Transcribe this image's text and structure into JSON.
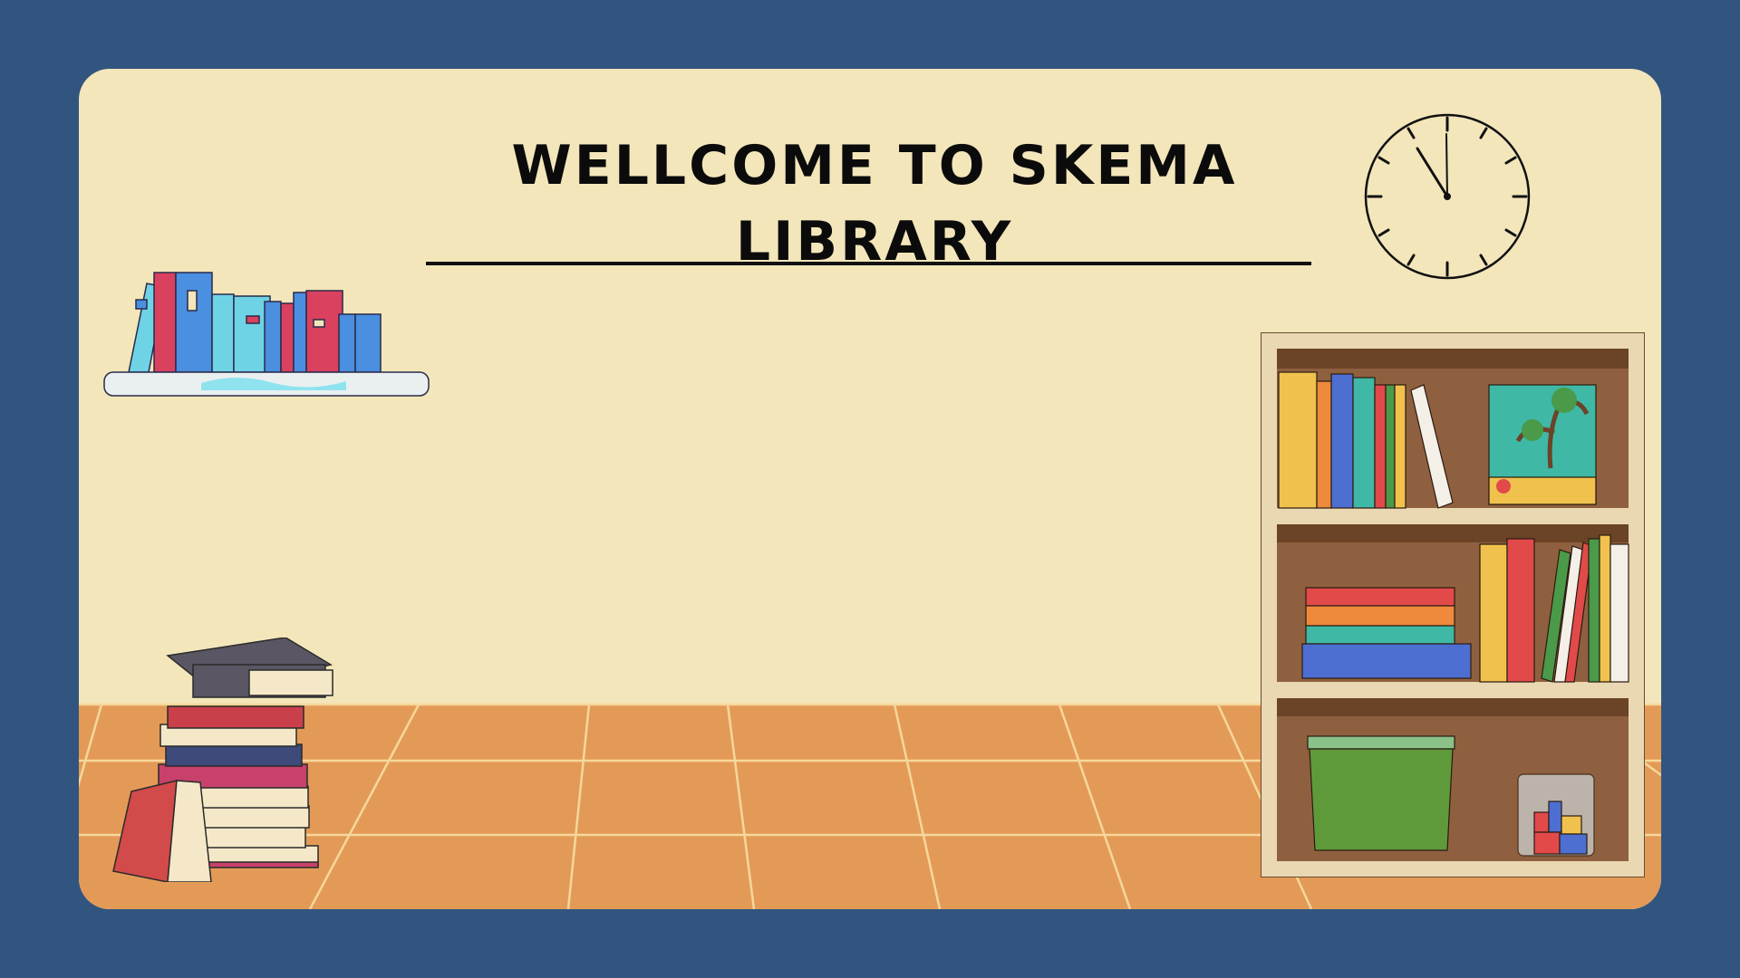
{
  "page": {
    "title": "WELLCOME TO SKEMA LIBRARY"
  },
  "colors": {
    "frame": "#325580",
    "wall": "#f3e6ba",
    "floor": "#e49a57",
    "floor_lines": "#f6d79a",
    "bookcase_wood": "#8f603f",
    "bookcase_frame": "#e9d8b2"
  },
  "icons": {
    "clock": "clock-icon",
    "wall_shelf": "wall-bookshelf-illustration",
    "book_stack": "book-stack-illustration",
    "bookcase": "bookcase-illustration"
  }
}
